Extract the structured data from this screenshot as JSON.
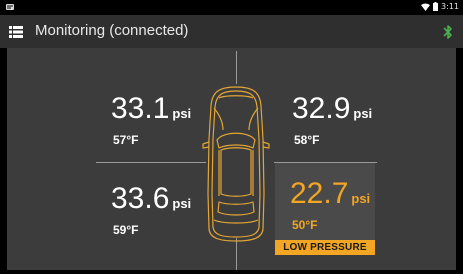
{
  "status_bar": {
    "time": "3:11",
    "icons": [
      "notification-icon",
      "wifi-icon",
      "battery-icon"
    ]
  },
  "app_bar": {
    "title": "Monitoring (connected)",
    "icons": [
      "menu-icon",
      "bluetooth-icon"
    ]
  },
  "tires": {
    "front_left": {
      "pressure": "33.1",
      "unit": "psi",
      "temp": "57°F"
    },
    "front_right": {
      "pressure": "32.9",
      "unit": "psi",
      "temp": "58°F"
    },
    "rear_left": {
      "pressure": "33.6",
      "unit": "psi",
      "temp": "59°F"
    },
    "rear_right": {
      "pressure": "22.7",
      "unit": "psi",
      "temp": "50°F",
      "warning": "LOW PRESSURE"
    }
  },
  "colors": {
    "alert": "#f2a623",
    "bluetooth": "#4caf50",
    "background": "#3c3c3c"
  }
}
